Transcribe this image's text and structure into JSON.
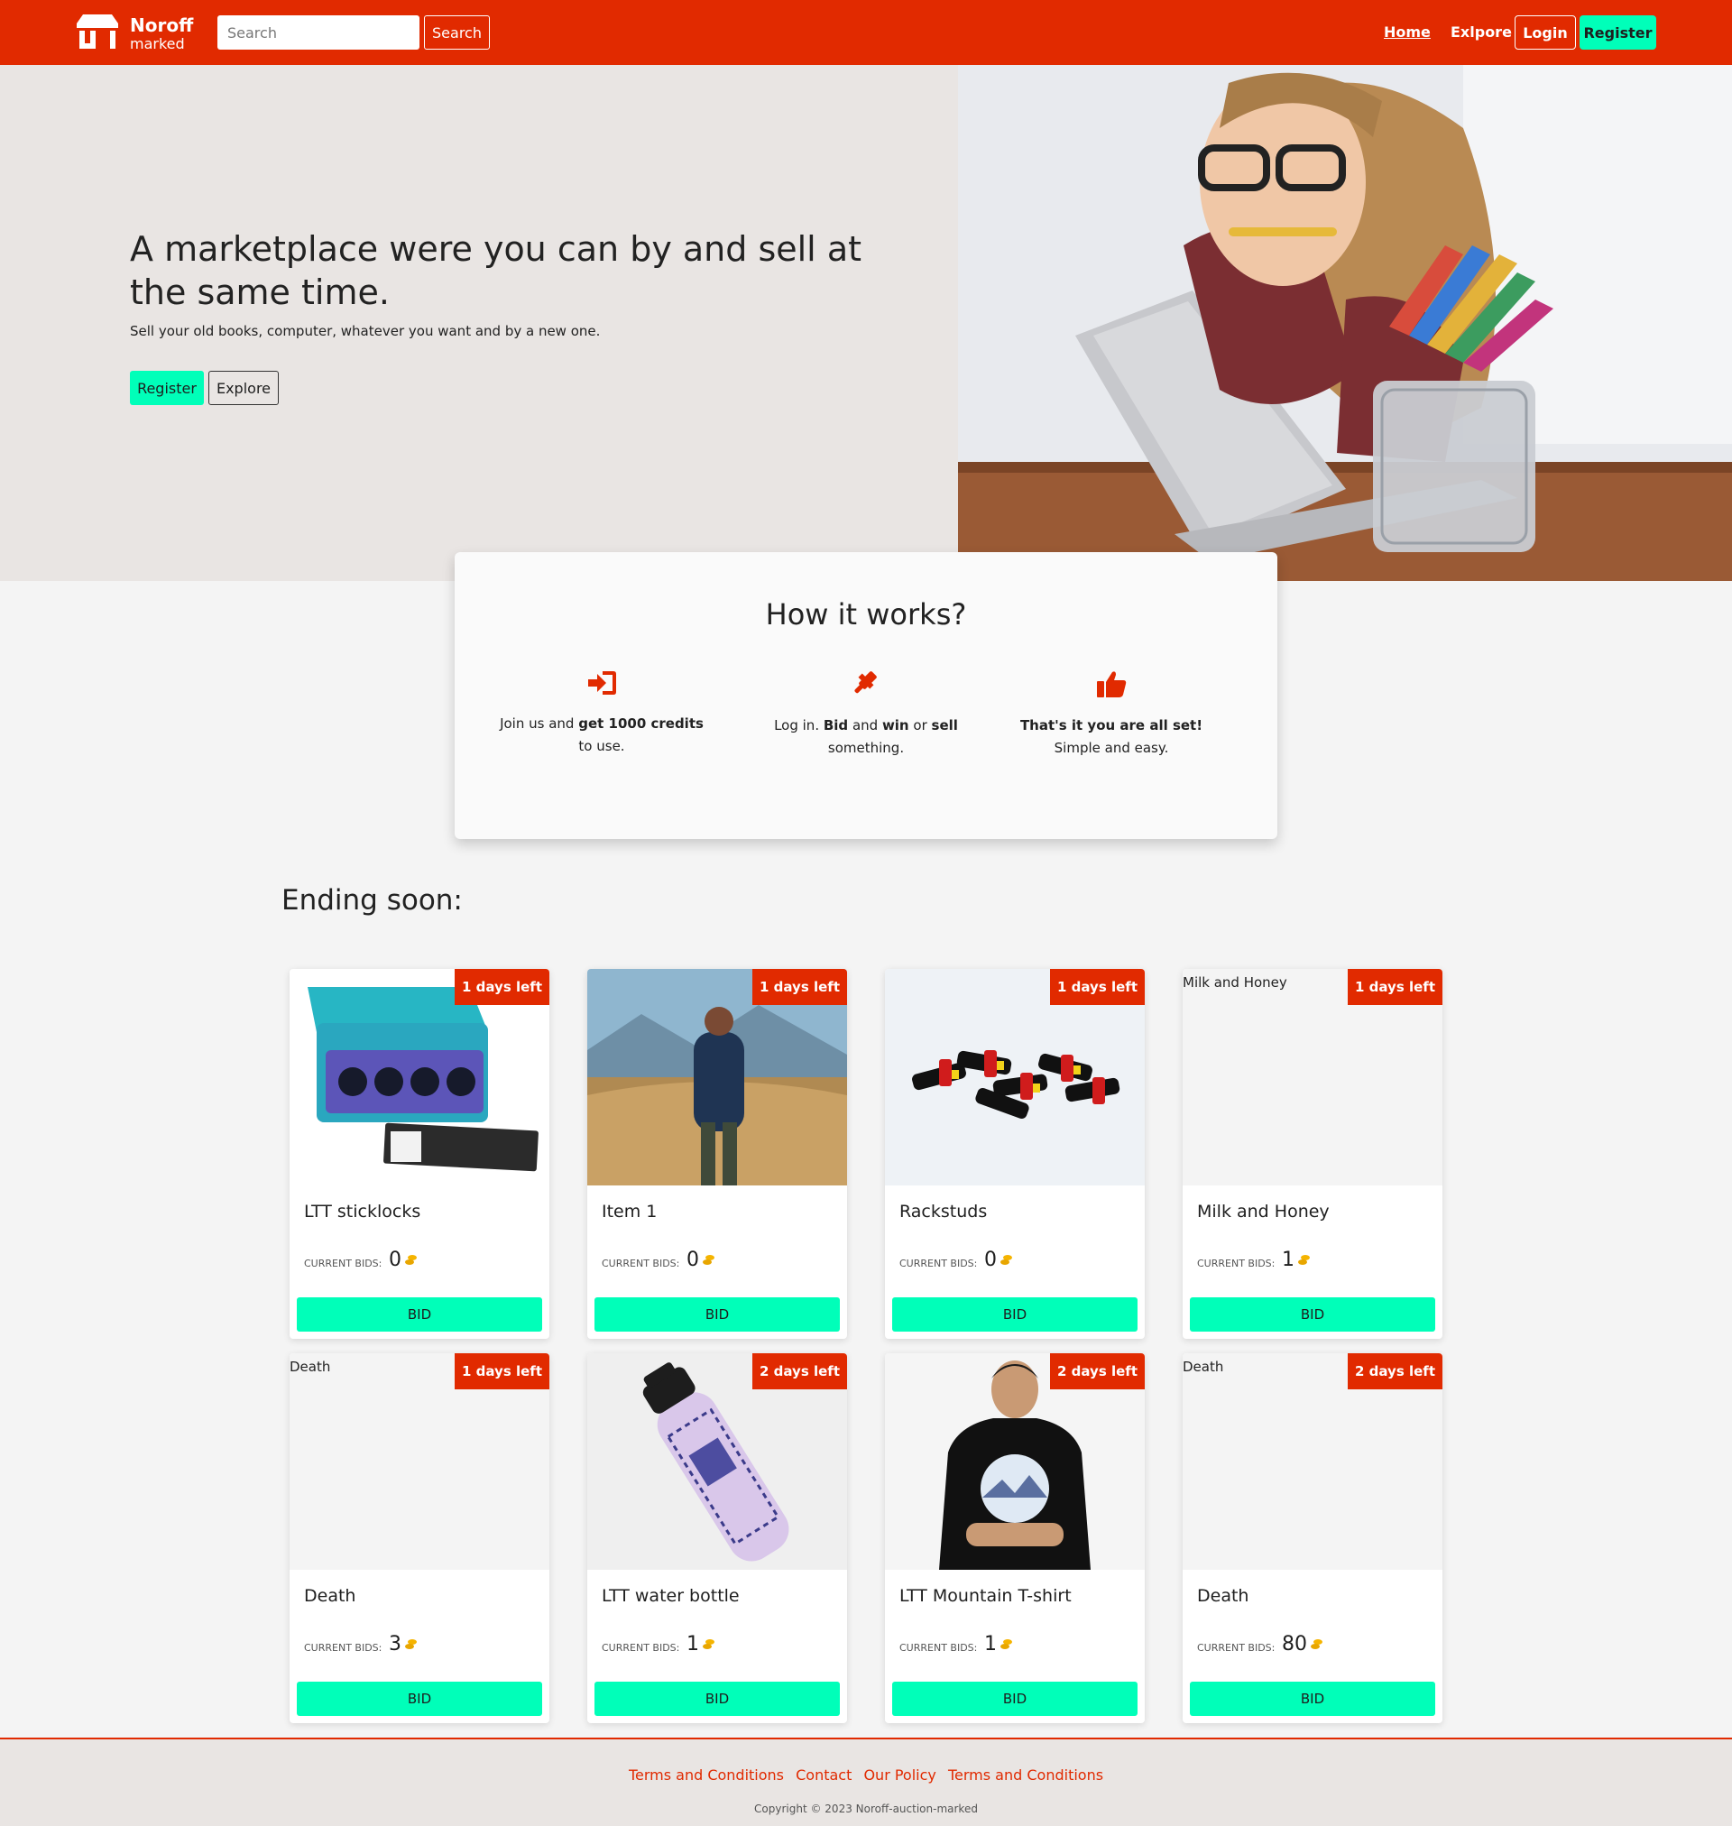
{
  "brand": {
    "name": "Noroff",
    "sub": "marked"
  },
  "search": {
    "placeholder": "Search",
    "button": "Search"
  },
  "nav": {
    "home": "Home",
    "explore": "Exlpore",
    "login": "Login",
    "register": "Register"
  },
  "hero": {
    "title": "A marketplace were you can by and sell at the same time.",
    "subtitle": "Sell your old books, computer, whatever you want and by a new one.",
    "register": "Register",
    "explore": "Explore"
  },
  "how": {
    "title": "How it works?",
    "steps": [
      {
        "icon": "sign-in-icon",
        "parts": [
          "Join us and ",
          "get 1000 credits",
          " to use."
        ]
      },
      {
        "icon": "gavel-icon",
        "parts": [
          "Log in. ",
          "Bid",
          " and ",
          "win",
          " or ",
          "sell",
          " something."
        ]
      },
      {
        "icon": "thumbs-up-icon",
        "parts": [
          "That's it you are all set!",
          "Simple and easy."
        ]
      }
    ]
  },
  "ending": {
    "title": "Ending soon:",
    "bids_label": "CURRENT BIDS:",
    "bid_button": "BID",
    "cards": [
      {
        "title": "LTT sticklocks",
        "badge": "1 days left",
        "bids": "0",
        "alt": ""
      },
      {
        "title": "Item 1",
        "badge": "1 days left",
        "bids": "0",
        "alt": ""
      },
      {
        "title": "Rackstuds",
        "badge": "1 days left",
        "bids": "0",
        "alt": ""
      },
      {
        "title": "Milk and Honey",
        "badge": "1 days left",
        "bids": "1",
        "alt": "Milk and Honey"
      },
      {
        "title": "Death",
        "badge": "1 days left",
        "bids": "3",
        "alt": "Death"
      },
      {
        "title": "LTT water bottle",
        "badge": "2 days left",
        "bids": "1",
        "alt": ""
      },
      {
        "title": "LTT Mountain T-shirt",
        "badge": "2 days left",
        "bids": "1",
        "alt": ""
      },
      {
        "title": "Death",
        "badge": "2 days left",
        "bids": "80",
        "alt": "Death"
      }
    ]
  },
  "footer": {
    "links": [
      "Terms and Conditions",
      "Contact",
      "Our Policy",
      "Terms and Conditions"
    ],
    "copyright": "Copyright © 2023 Noroff-auction-marked"
  },
  "colors": {
    "primary": "#e12a00",
    "accent": "#00ffb9",
    "hero_bg": "#e9e5e3",
    "coin": "#f5b400"
  }
}
